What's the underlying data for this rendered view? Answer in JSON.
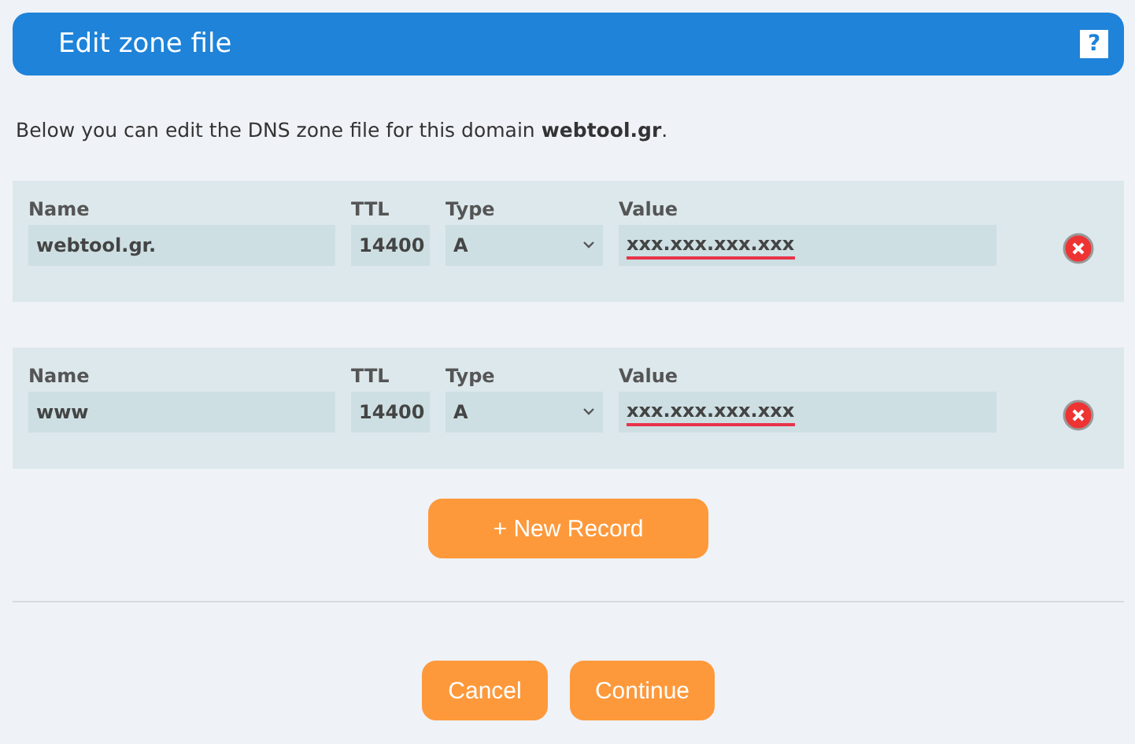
{
  "header": {
    "title": "Edit zone file",
    "help": "?"
  },
  "intro": "Below you can edit the DNS zone file for this domain **webtool.gr**.",
  "records": [
    {
      "name_label": "Name",
      "name": "webtool.gr.",
      "ttl_label": "TTL",
      "ttl": "14400",
      "type_label": "Type",
      "type": "A",
      "value_label": "Value",
      "value": "xxx.xxx.xxx.xxx",
      "spellcheck_error": true
    },
    {
      "name_label": "Name",
      "name": "www",
      "ttl_label": "TTL",
      "ttl": "14400",
      "type_label": "Type",
      "type": "A",
      "value_label": "Value",
      "value": "xxx.xxx.xxx.xxx",
      "spellcheck_error": true
    }
  ],
  "new_record": "+ New Record",
  "buttons": [
    "Cancel",
    "Continue"
  ]
}
